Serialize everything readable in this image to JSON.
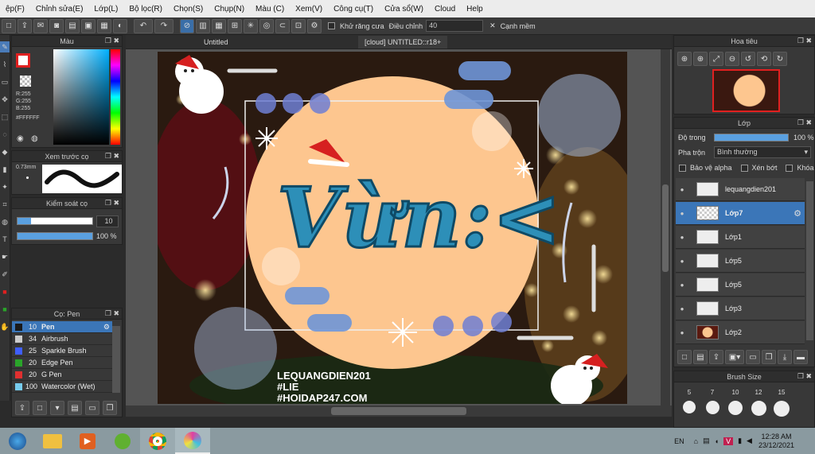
{
  "menu": [
    "ệp(F)",
    "Chỉnh sửa(E)",
    "Lớp(L)",
    "Bộ lọc(R)",
    "Chọn(S)",
    "Chụp(N)",
    "Màu (C)",
    "Xem(V)",
    "Công cụ(T)",
    "Cửa sổ(W)",
    "Cloud",
    "Help"
  ],
  "toolbar": {
    "antialias_label": "Khử răng cưa",
    "adjust_label": "Điều chỉnh",
    "adjust_value": "40",
    "soft_edge_label": "Cạnh mềm"
  },
  "color_panel": {
    "title": "Màu",
    "r": "R:255",
    "g": "G:255",
    "b": "B:255",
    "hex": "#FFFFFF",
    "fg_color": "#e02020"
  },
  "brush_preview": {
    "title": "Xem trước cọ",
    "size": "0.73mm"
  },
  "brush_control": {
    "title": "Kiểm soát cọ",
    "size_value": "10",
    "opacity_value": "100 %"
  },
  "brush_list": {
    "title": "Cọ: Pen",
    "items": [
      {
        "size": "10",
        "name": "Pen",
        "color": "#1a1a1a",
        "selected": true
      },
      {
        "size": "34",
        "name": "Airbrush",
        "color": "#cccccc"
      },
      {
        "size": "25",
        "name": "Sparkle Brush",
        "color": "#3f5fff"
      },
      {
        "size": "20",
        "name": "Edge Pen",
        "color": "#2aa52a"
      },
      {
        "size": "20",
        "name": "G Pen",
        "color": "#e03030"
      },
      {
        "size": "100",
        "name": "Watercolor (Wet)",
        "color": "#77ccee"
      }
    ]
  },
  "doc": {
    "tab_untitled": "Untitled",
    "tab_cloud": "[cloud] UNTITLED::r18+"
  },
  "canvas_text": {
    "main": "Vừn:<",
    "watermark_1": "LEQUANGDIEN201",
    "watermark_2": "#LIE",
    "watermark_3": "#HOIDAP247.COM"
  },
  "navigator": {
    "title": "Hoa tiêu"
  },
  "layers": {
    "title": "Lớp",
    "opacity_label": "Độ trong",
    "opacity_value": "100 %",
    "blend_label": "Pha trộn",
    "blend_value": "Bình thường",
    "protect_alpha": "Bảo vệ alpha",
    "clip": "Xén bớt",
    "lock": "Khóa",
    "items": [
      {
        "name": "lequangdien201",
        "selected": false
      },
      {
        "name": "Lớp7",
        "selected": true
      },
      {
        "name": "Lớp1",
        "selected": false
      },
      {
        "name": "Lớp5",
        "selected": false
      },
      {
        "name": "Lớp5",
        "selected": false
      },
      {
        "name": "Lớp3",
        "selected": false
      },
      {
        "name": "Lớp2",
        "selected": false
      }
    ]
  },
  "brush_size": {
    "title": "Brush Size",
    "sizes": [
      "5",
      "7",
      "10",
      "12",
      "15"
    ]
  },
  "taskbar": {
    "lang": "EN",
    "time": "12:28 AM",
    "date": "23/12/2021"
  }
}
